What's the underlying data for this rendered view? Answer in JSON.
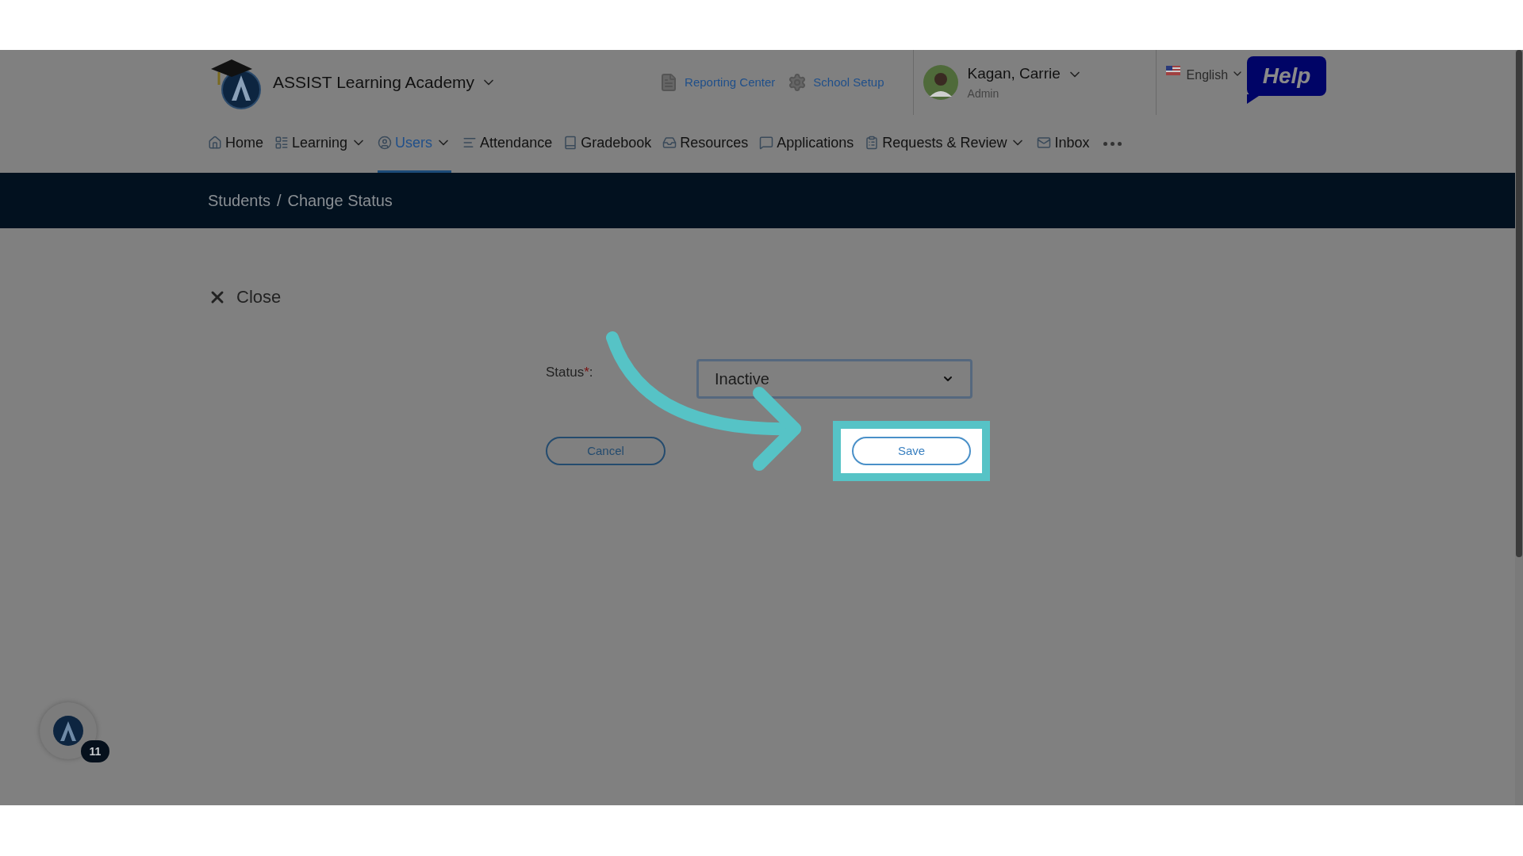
{
  "header": {
    "school_name": "ASSIST Learning Academy",
    "links": [
      {
        "label": "Reporting Center"
      },
      {
        "label": "School Setup"
      }
    ],
    "user": {
      "name": "Kagan, Carrie",
      "role": "Admin"
    },
    "language": "English",
    "help": "Help"
  },
  "nav": [
    {
      "label": "Home",
      "selected": false,
      "has_menu": false
    },
    {
      "label": "Learning",
      "selected": false,
      "has_menu": true
    },
    {
      "label": "Users",
      "selected": true,
      "has_menu": true
    },
    {
      "label": "Attendance",
      "selected": false,
      "has_menu": false
    },
    {
      "label": "Gradebook",
      "selected": false,
      "has_menu": false
    },
    {
      "label": "Resources",
      "selected": false,
      "has_menu": false
    },
    {
      "label": "Applications",
      "selected": false,
      "has_menu": false
    },
    {
      "label": "Requests & Review",
      "selected": false,
      "has_menu": true
    },
    {
      "label": "Inbox",
      "selected": false,
      "has_menu": false
    }
  ],
  "breadcrumb": [
    {
      "label": "Students"
    },
    {
      "label": "Change Status"
    }
  ],
  "breadcrumb_separator": "/",
  "close": "Close",
  "form": {
    "status_label": "Status",
    "required_mark": "*",
    "label_suffix": ":",
    "status_value": "Inactive",
    "cancel": "Cancel",
    "save": "Save",
    "save_highlighted": true
  },
  "chat_badge": "11"
}
